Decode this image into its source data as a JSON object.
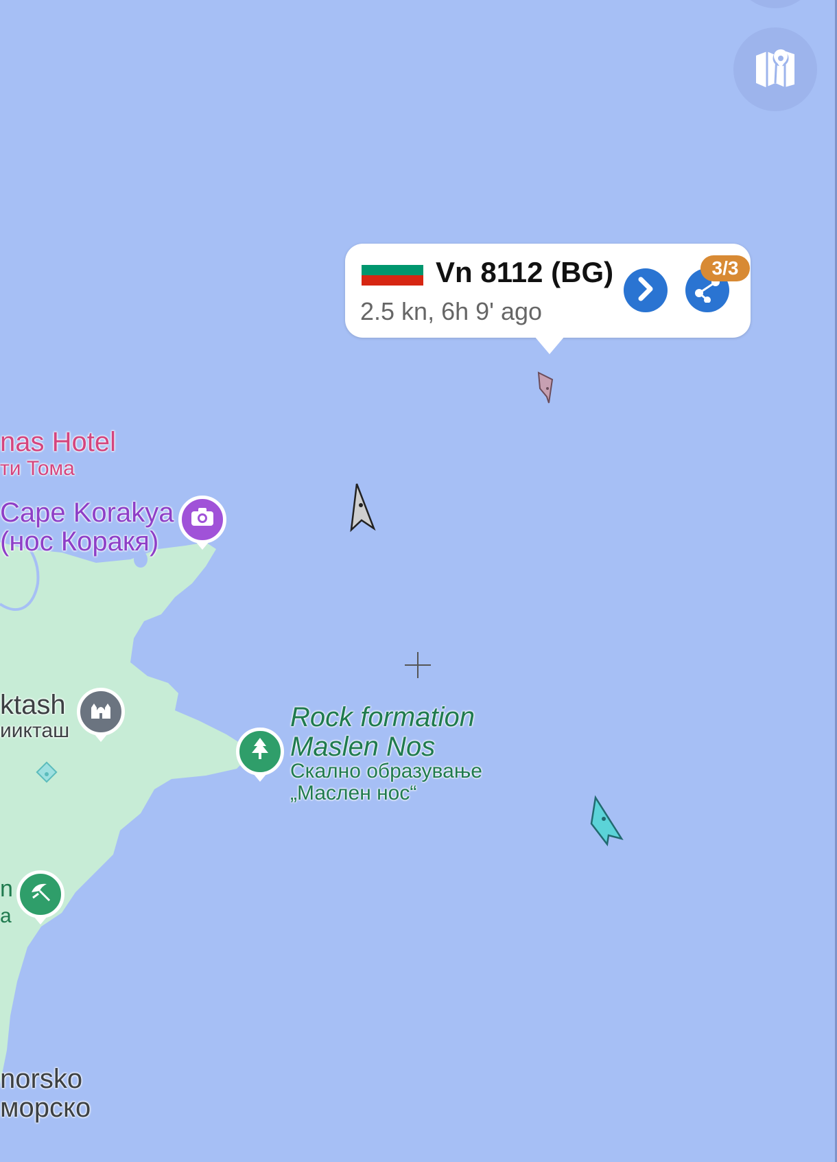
{
  "popup": {
    "vessel_name": "Vn 8112 (BG)",
    "subtitle": "2.5 kn, 6h 9' ago",
    "badge": "3/3",
    "flag_colors": [
      "#ffffff",
      "#00966e",
      "#d62612"
    ]
  },
  "places": {
    "hotel_en": "nas Hotel",
    "hotel_bg": "ти Тома",
    "cape_en": "Cape Korakya",
    "cape_bg": "(нос Коракя)",
    "aktash_en": "ktash",
    "aktash_bg": "иикташ",
    "rock_en_1": "Rock formation",
    "rock_en_2": "Maslen Nos",
    "rock_bg_1": "Скално образување",
    "rock_bg_2": "„Маслен нос“",
    "left_partial_1": "n",
    "left_partial_2": "a",
    "morsko_en": "norsko",
    "morsko_bg": "морско"
  },
  "icons": {
    "layers": "map-layers-icon",
    "photo": "camera-icon",
    "mosque": "mosque-icon",
    "park": "tree-icon",
    "beach": "beach-umbrella-icon"
  },
  "colors": {
    "sea": "#a6bff5",
    "land": "#c7ecd6",
    "accent": "#2a74d2",
    "badge": "#d88a34"
  }
}
